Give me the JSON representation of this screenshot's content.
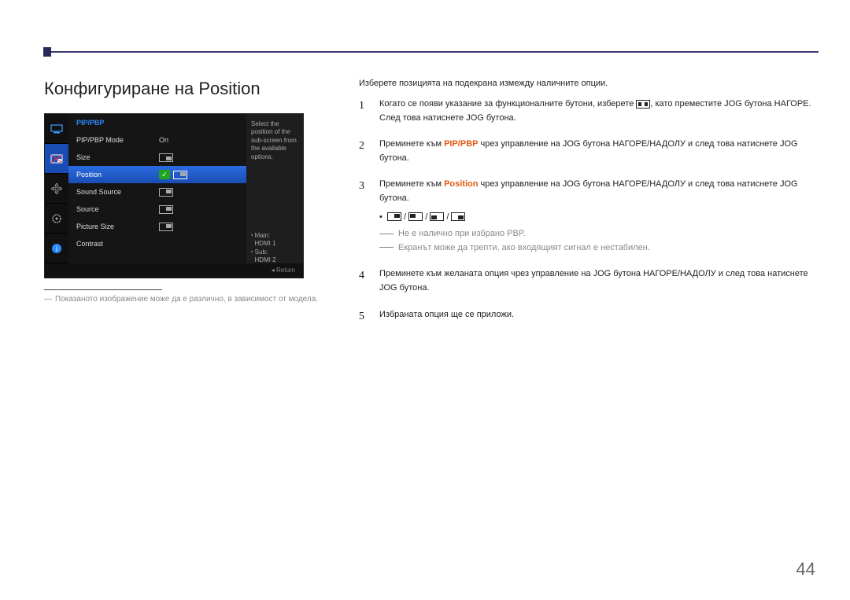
{
  "page": {
    "title": "Конфигуриране на Position",
    "pageNumber": "44"
  },
  "osd": {
    "title": "PIP/PBP",
    "rows": {
      "mode": {
        "label": "PIP/PBP Mode",
        "value": "On"
      },
      "size": {
        "label": "Size"
      },
      "position": {
        "label": "Position"
      },
      "sound": {
        "label": "Sound Source"
      },
      "source": {
        "label": "Source"
      },
      "picsize": {
        "label": "Picture Size"
      },
      "contrast": {
        "label": "Contrast"
      }
    },
    "side": {
      "help": "Select the position of the sub-screen from the available options.",
      "mainLabel": "Main:",
      "mainVal": "HDMI 1",
      "subLabel": "Sub:",
      "subVal": "HDMI 2"
    },
    "footer": "◂  Return"
  },
  "leftNote": "Показаното изображение може да е различно, в зависимост от модела.",
  "intro": "Изберете позицията на подекрана измежду наличните опции.",
  "steps": {
    "1": {
      "pre": "Когато се появи указание за функционалните бутони, изберете ",
      "post": ", като преместите JOG бутона НАГОРЕ. След това натиснете JOG бутона."
    },
    "2": {
      "pre": "Преминете към ",
      "hl": "PIP/PBP",
      "post": " чрез управление на JOG бутона НАГОРЕ/НАДОЛУ и след това натиснете JOG бутона."
    },
    "3": {
      "pre": "Преминете към ",
      "hl": "Position",
      "post": " чрез управление на JOG бутона НАГОРЕ/НАДОЛУ и след това натиснете JOG бутона.",
      "note1": "Не е налично при избрано PBP.",
      "note2": "Екранът може да трепти, ако входящият сигнал е нестабилен."
    },
    "4": "Преминете към желаната опция чрез управление на JOG бутона НАГОРЕ/НАДОЛУ и след това натиснете JOG бутона.",
    "5": "Избраната опция ще се приложи."
  }
}
